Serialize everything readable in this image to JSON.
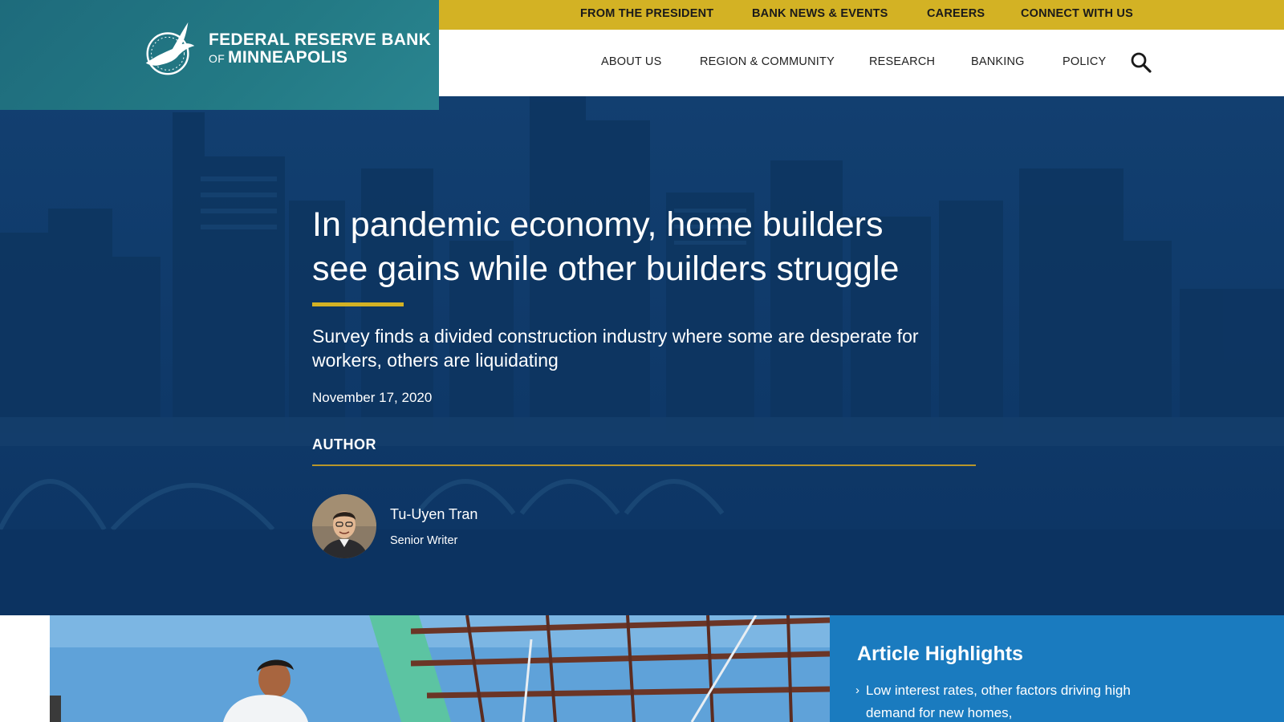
{
  "logo": {
    "line1": "FEDERAL RESERVE BANK",
    "line2_of": "OF",
    "line2": "MINNEAPOLIS",
    "icon": "eagle-seal-icon"
  },
  "utility_nav": [
    {
      "label": "FROM THE PRESIDENT"
    },
    {
      "label": "BANK NEWS & EVENTS"
    },
    {
      "label": "CAREERS"
    },
    {
      "label": "CONNECT WITH US"
    }
  ],
  "main_nav": [
    {
      "label": "ABOUT US"
    },
    {
      "label": "REGION & COMMUNITY"
    },
    {
      "label": "RESEARCH"
    },
    {
      "label": "BANKING"
    },
    {
      "label": "POLICY"
    }
  ],
  "search": {
    "icon": "search-icon"
  },
  "article": {
    "title_line1": "In pandemic economy, home builders",
    "title_line2": "see gains while other builders struggle",
    "subtitle": "Survey finds a divided construction industry where some are desperate for workers, others are liquidating",
    "date": "November 17, 2020",
    "author_heading": "AUTHOR",
    "author": {
      "name": "Tu-Uyen Tran",
      "role": "Senior Writer"
    }
  },
  "highlights": {
    "title": "Article Highlights",
    "items": [
      {
        "text": "Low interest rates, other factors driving high demand for new homes,"
      }
    ]
  },
  "colors": {
    "gold": "#d3b224",
    "teal": "#1e6b7c",
    "hero_blue": "#0f3a68",
    "highlight_blue": "#1a7bbf"
  }
}
